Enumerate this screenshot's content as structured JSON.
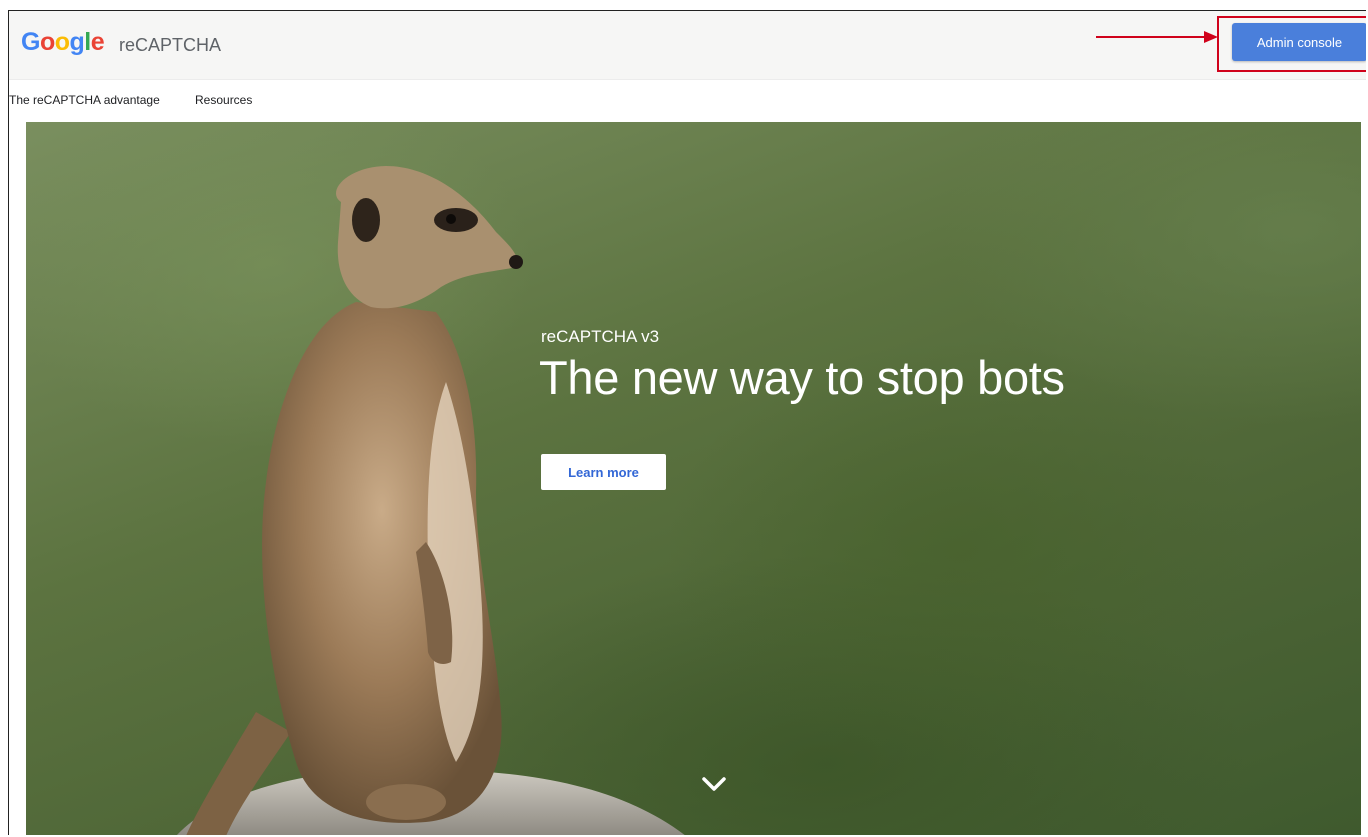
{
  "header": {
    "logo": {
      "letters": [
        "G",
        "o",
        "o",
        "g",
        "l",
        "e"
      ],
      "colors": [
        "#4285f4",
        "#ea4335",
        "#fbbc05",
        "#4285f4",
        "#34a853",
        "#ea4335"
      ]
    },
    "product_name": "reCAPTCHA",
    "admin_button_label": "Admin console",
    "admin_button_color": "#4a7fdb",
    "highlight_color": "#d0021b"
  },
  "nav": {
    "items": [
      {
        "label": "The reCAPTCHA advantage"
      },
      {
        "label": "Resources"
      }
    ]
  },
  "hero": {
    "subtitle": "reCAPTCHA v3",
    "title": "The new way to stop bots",
    "cta_label": "Learn more",
    "scroll_icon": "chevron-down-icon"
  }
}
